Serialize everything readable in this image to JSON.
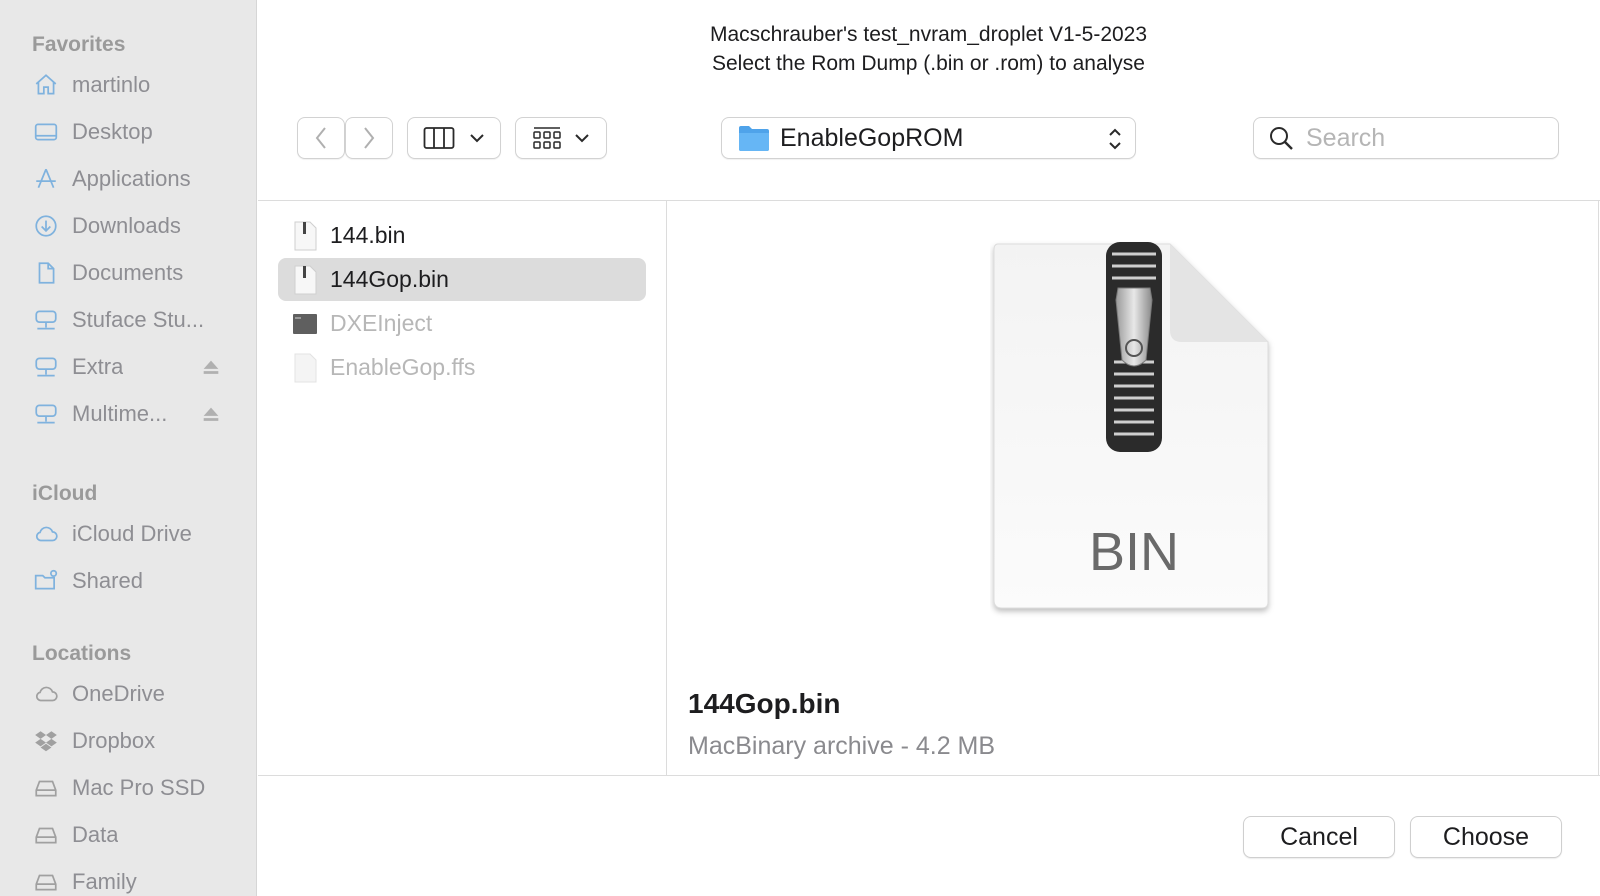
{
  "window": {
    "title_line1": "Macschrauber's test_nvram_droplet V1-5-2023",
    "title_line2": "Select the Rom Dump (.bin or .rom) to analyse"
  },
  "sidebar": {
    "favorites_header": "Favorites",
    "favorites": [
      {
        "label": "martinlo",
        "icon": "home-icon"
      },
      {
        "label": "Desktop",
        "icon": "desktop-icon"
      },
      {
        "label": "Applications",
        "icon": "applications-icon"
      },
      {
        "label": "Downloads",
        "icon": "downloads-icon"
      },
      {
        "label": "Documents",
        "icon": "document-icon"
      },
      {
        "label": "Stuface Stu...",
        "icon": "network-drive-icon"
      },
      {
        "label": "Extra",
        "icon": "network-drive-icon",
        "eject": true
      },
      {
        "label": "Multime...",
        "icon": "network-drive-icon",
        "eject": true
      }
    ],
    "icloud_header": "iCloud",
    "icloud": [
      {
        "label": "iCloud Drive",
        "icon": "cloud-icon"
      },
      {
        "label": "Shared",
        "icon": "shared-folder-icon"
      }
    ],
    "locations_header": "Locations",
    "locations": [
      {
        "label": "OneDrive",
        "icon": "cloud-icon"
      },
      {
        "label": "Dropbox",
        "icon": "dropbox-icon"
      },
      {
        "label": "Mac Pro SSD",
        "icon": "drive-icon"
      },
      {
        "label": "Data",
        "icon": "drive-icon"
      },
      {
        "label": "Family",
        "icon": "drive-icon"
      }
    ]
  },
  "toolbar": {
    "current_folder": "EnableGopROM",
    "search_placeholder": "Search"
  },
  "files": [
    {
      "name": "144.bin",
      "selected": false,
      "disabled": false,
      "icon": "bin-file-icon"
    },
    {
      "name": "144Gop.bin",
      "selected": true,
      "disabled": false,
      "icon": "bin-file-icon"
    },
    {
      "name": "DXEInject",
      "selected": false,
      "disabled": true,
      "icon": "executable-icon"
    },
    {
      "name": "EnableGop.ffs",
      "selected": false,
      "disabled": true,
      "icon": "blank-file-icon"
    }
  ],
  "preview": {
    "icon_label": "BIN",
    "file_name": "144Gop.bin",
    "file_meta": "MacBinary archive - 4.2 MB"
  },
  "buttons": {
    "cancel": "Cancel",
    "choose": "Choose"
  },
  "colors": {
    "sidebar_bg": "#e8e8e8",
    "selection_bg": "#dcdcdc",
    "folder_blue": "#5aaef0",
    "sidebar_icon": "#6fa8d8"
  }
}
